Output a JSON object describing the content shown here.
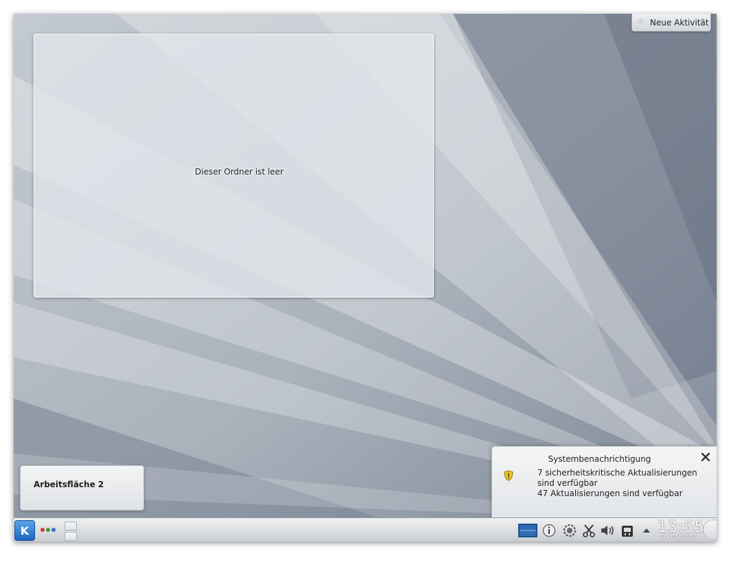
{
  "activity_button": {
    "label": "Neue Aktivität",
    "icon": "gear-icon"
  },
  "folder_view": {
    "empty_text": "Dieser Ordner ist leer"
  },
  "desktop_label": {
    "text": "Arbeitsfläche 2"
  },
  "notification": {
    "title": "Systembenachrichtigung",
    "lines": [
      "7 sicherheitskritische Aktualisierungen sind verfügbar",
      "47 Aktualisierungen sind verfügbar"
    ],
    "icon": "warning-shield-icon"
  },
  "taskbar": {
    "kmenu_icon": "kde-logo-icon",
    "tray_icons": [
      "screen-preview-icon",
      "info-icon",
      "network-icon",
      "scissors-icon",
      "volume-icon",
      "device-icon",
      "expand-arrow-icon"
    ]
  },
  "clock": {
    "time": "13:55",
    "date": "05.05.2012"
  },
  "colors": {
    "wallpaper_dark": "#6b7384",
    "wallpaper_light": "#e9ecef",
    "kmenu_blue": "#2a75d0"
  }
}
